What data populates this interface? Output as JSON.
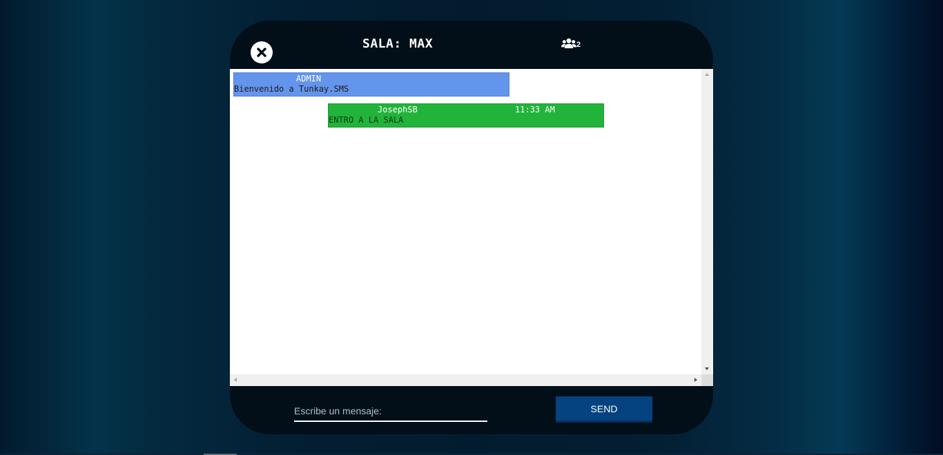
{
  "header": {
    "room_title": "SALA: MAX",
    "user_count": "2",
    "close_icon": "close-circle-icon",
    "users_icon": "users-group-icon"
  },
  "messages": [
    {
      "sender": "ADMIN",
      "time": "",
      "text": "Bienvenido a Tunkay.SMS",
      "color": "#6495ed"
    },
    {
      "sender": "JosephSB",
      "time": "11:33 AM",
      "text": "ENTRO A LA SALA",
      "color": "#22b33a"
    }
  ],
  "composer": {
    "placeholder": "Escribe un mensaje:",
    "value": "",
    "send_label": "SEND"
  },
  "colors": {
    "window_bg": "#020f18",
    "send_button": "#054280"
  }
}
